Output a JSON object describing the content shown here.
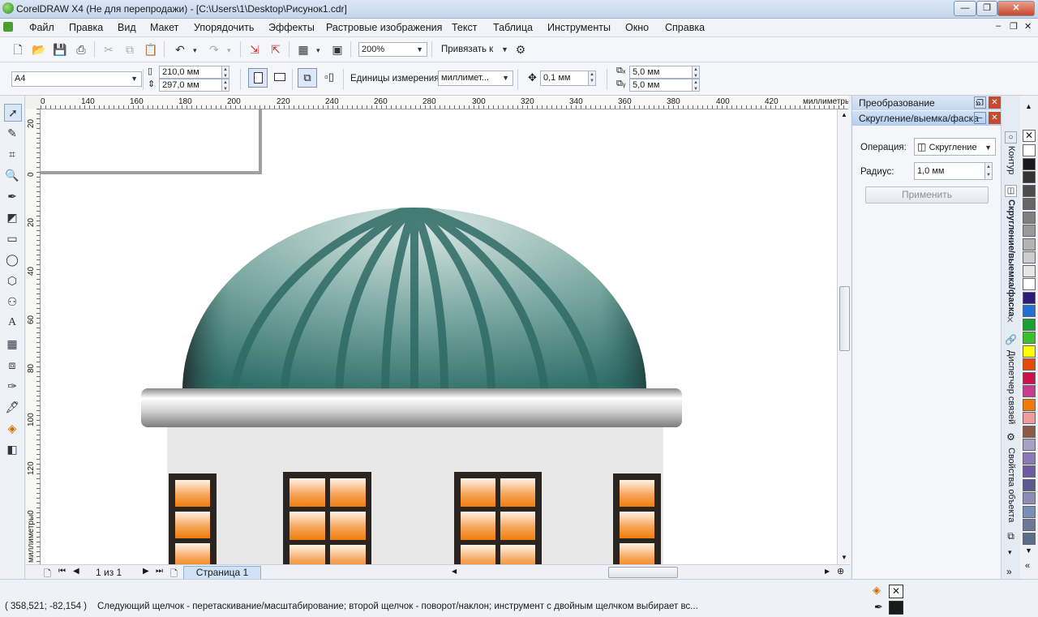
{
  "window": {
    "title": "CorelDRAW X4 (Не для перепродажи) - [C:\\Users\\1\\Desktop\\Рисунок1.cdr]",
    "minimize": "—",
    "restore": "❐",
    "close": "✕"
  },
  "menu": [
    "Файл",
    "Правка",
    "Вид",
    "Макет",
    "Упорядочить",
    "Эффекты",
    "Растровые изображения",
    "Текст",
    "Таблица",
    "Инструменты",
    "Окно",
    "Справка"
  ],
  "standard_toolbar": {
    "zoom": "200%",
    "snap_label": "Привязать к"
  },
  "property_bar": {
    "paper_size": "A4",
    "width": "210,0 мм",
    "height": "297,0 мм",
    "units_label": "Единицы измерения:",
    "units_value": "миллимет...",
    "nudge": "0,1 мм",
    "dup_x": "5,0 мм",
    "dup_y": "5,0 мм"
  },
  "ruler": {
    "h_ticks": [
      "0",
      "140",
      "160",
      "180",
      "200",
      "220",
      "240",
      "260",
      "280",
      "300",
      "320",
      "340",
      "360",
      "380",
      "400",
      "420"
    ],
    "h_units": "миллиметры",
    "v_ticks": [
      "20",
      "0",
      "20",
      "40",
      "60",
      "80",
      "100",
      "120",
      "140"
    ],
    "v_units": "миллиметры"
  },
  "docker": {
    "header1": "Преобразование",
    "header2": "Скругление/выемка/фаска",
    "operation_label": "Операция:",
    "operation_value": "Скругление",
    "radius_label": "Радиус:",
    "radius_value": "1,0 мм",
    "apply_button": "Применить",
    "tabs": [
      "Контур",
      "Скругление/выемка/фаска",
      "Диспетчер связей",
      "Свойства объекта"
    ]
  },
  "page_nav": {
    "counter": "1 из 1",
    "tab": "Страница 1"
  },
  "status": {
    "coords": "( 358,521; -82,154 )",
    "message": "Следующий щелчок - перетаскивание/масштабирование; второй щелчок - поворот/наклон; инструмент с двойным щелчком выбирает вс..."
  },
  "colors": {
    "palette": [
      "#ffffff",
      "#1a1a1a",
      "#333333",
      "#4d4d4d",
      "#666666",
      "#808080",
      "#999999",
      "#b3b3b3",
      "#cccccc",
      "#e6e6e6",
      "#ffffff",
      "#2e1a7a",
      "#1f6fd6",
      "#1aa032",
      "#3cbf2c",
      "#ffff00",
      "#e64a0a",
      "#c8144a",
      "#c83c8c",
      "#f07a0a",
      "#f09a9a",
      "#8c5a46",
      "#a8a0c8",
      "#8c78b4",
      "#6e5aa0",
      "#5a5a8c",
      "#8c8cb4",
      "#7890b4",
      "#6e7896",
      "#5a6e8c"
    ],
    "dome_dark": "#2f6e68",
    "window_orange": "#f07d0a"
  }
}
